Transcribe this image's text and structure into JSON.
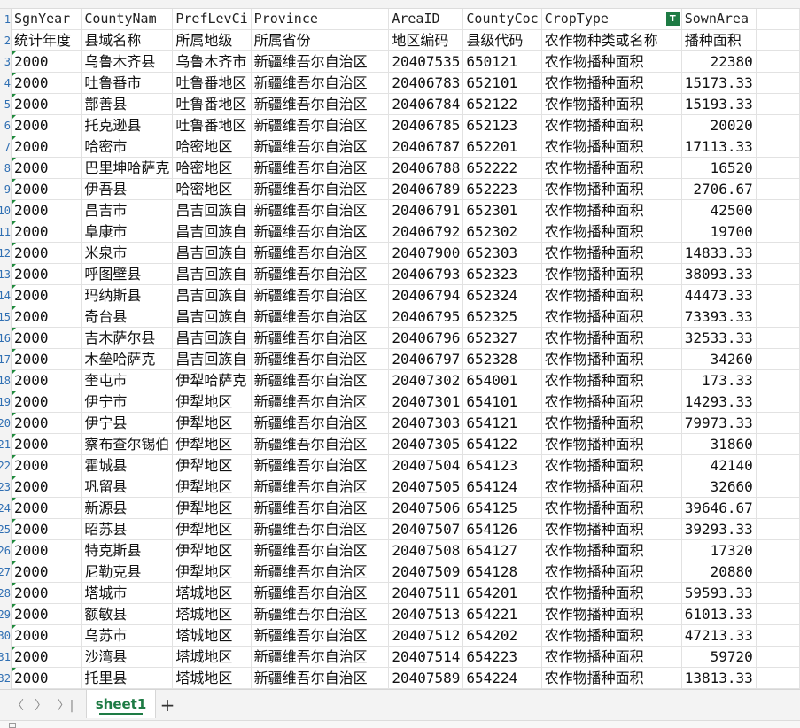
{
  "headers_en": [
    "SgnYear",
    "CountyNam",
    "PrefLevCi",
    "Province",
    "AreaID",
    "CountyCoc",
    "CropType",
    "SownArea"
  ],
  "headers_cn": [
    "统计年度",
    "县域名称",
    "所属地级",
    "所属省份",
    "地区编码",
    "县级代码",
    "农作物种类或名称",
    "播种面积"
  ],
  "rows": [
    [
      "2000",
      "乌鲁木齐县",
      "乌鲁木齐市",
      "新疆维吾尔自治区",
      "20407535",
      "650121",
      "农作物播种面积",
      "22380"
    ],
    [
      "2000",
      "吐鲁番市",
      "吐鲁番地区",
      "新疆维吾尔自治区",
      "20406783",
      "652101",
      "农作物播种面积",
      "15173.33"
    ],
    [
      "2000",
      "鄯善县",
      "吐鲁番地区",
      "新疆维吾尔自治区",
      "20406784",
      "652122",
      "农作物播种面积",
      "15193.33"
    ],
    [
      "2000",
      "托克逊县",
      "吐鲁番地区",
      "新疆维吾尔自治区",
      "20406785",
      "652123",
      "农作物播种面积",
      "20020"
    ],
    [
      "2000",
      "哈密市",
      "哈密地区",
      "新疆维吾尔自治区",
      "20406787",
      "652201",
      "农作物播种面积",
      "17113.33"
    ],
    [
      "2000",
      "巴里坤哈萨克",
      "哈密地区",
      "新疆维吾尔自治区",
      "20406788",
      "652222",
      "农作物播种面积",
      "16520"
    ],
    [
      "2000",
      "伊吾县",
      "哈密地区",
      "新疆维吾尔自治区",
      "20406789",
      "652223",
      "农作物播种面积",
      "2706.67"
    ],
    [
      "2000",
      "昌吉市",
      "昌吉回族自",
      "新疆维吾尔自治区",
      "20406791",
      "652301",
      "农作物播种面积",
      "42500"
    ],
    [
      "2000",
      "阜康市",
      "昌吉回族自",
      "新疆维吾尔自治区",
      "20406792",
      "652302",
      "农作物播种面积",
      "19700"
    ],
    [
      "2000",
      "米泉市",
      "昌吉回族自",
      "新疆维吾尔自治区",
      "20407900",
      "652303",
      "农作物播种面积",
      "14833.33"
    ],
    [
      "2000",
      "呼图壁县",
      "昌吉回族自",
      "新疆维吾尔自治区",
      "20406793",
      "652323",
      "农作物播种面积",
      "38093.33"
    ],
    [
      "2000",
      "玛纳斯县",
      "昌吉回族自",
      "新疆维吾尔自治区",
      "20406794",
      "652324",
      "农作物播种面积",
      "44473.33"
    ],
    [
      "2000",
      "奇台县",
      "昌吉回族自",
      "新疆维吾尔自治区",
      "20406795",
      "652325",
      "农作物播种面积",
      "73393.33"
    ],
    [
      "2000",
      "吉木萨尔县",
      "昌吉回族自",
      "新疆维吾尔自治区",
      "20406796",
      "652327",
      "农作物播种面积",
      "32533.33"
    ],
    [
      "2000",
      "木垒哈萨克",
      "昌吉回族自",
      "新疆维吾尔自治区",
      "20406797",
      "652328",
      "农作物播种面积",
      "34260"
    ],
    [
      "2000",
      "奎屯市",
      "伊犁哈萨克",
      "新疆维吾尔自治区",
      "20407302",
      "654001",
      "农作物播种面积",
      "173.33"
    ],
    [
      "2000",
      "伊宁市",
      "伊犁地区",
      "新疆维吾尔自治区",
      "20407301",
      "654101",
      "农作物播种面积",
      "14293.33"
    ],
    [
      "2000",
      "伊宁县",
      "伊犁地区",
      "新疆维吾尔自治区",
      "20407303",
      "654121",
      "农作物播种面积",
      "79973.33"
    ],
    [
      "2000",
      "察布查尔锡伯",
      "伊犁地区",
      "新疆维吾尔自治区",
      "20407305",
      "654122",
      "农作物播种面积",
      "31860"
    ],
    [
      "2000",
      "霍城县",
      "伊犁地区",
      "新疆维吾尔自治区",
      "20407504",
      "654123",
      "农作物播种面积",
      "42140"
    ],
    [
      "2000",
      "巩留县",
      "伊犁地区",
      "新疆维吾尔自治区",
      "20407505",
      "654124",
      "农作物播种面积",
      "32660"
    ],
    [
      "2000",
      "新源县",
      "伊犁地区",
      "新疆维吾尔自治区",
      "20407506",
      "654125",
      "农作物播种面积",
      "39646.67"
    ],
    [
      "2000",
      "昭苏县",
      "伊犁地区",
      "新疆维吾尔自治区",
      "20407507",
      "654126",
      "农作物播种面积",
      "39293.33"
    ],
    [
      "2000",
      "特克斯县",
      "伊犁地区",
      "新疆维吾尔自治区",
      "20407508",
      "654127",
      "农作物播种面积",
      "17320"
    ],
    [
      "2000",
      "尼勒克县",
      "伊犁地区",
      "新疆维吾尔自治区",
      "20407509",
      "654128",
      "农作物播种面积",
      "20880"
    ],
    [
      "2000",
      "塔城市",
      "塔城地区",
      "新疆维吾尔自治区",
      "20407511",
      "654201",
      "农作物播种面积",
      "59593.33"
    ],
    [
      "2000",
      "额敏县",
      "塔城地区",
      "新疆维吾尔自治区",
      "20407513",
      "654221",
      "农作物播种面积",
      "61013.33"
    ],
    [
      "2000",
      "乌苏市",
      "塔城地区",
      "新疆维吾尔自治区",
      "20407512",
      "654202",
      "农作物播种面积",
      "47213.33"
    ],
    [
      "2000",
      "沙湾县",
      "塔城地区",
      "新疆维吾尔自治区",
      "20407514",
      "654223",
      "农作物播种面积",
      "59720"
    ],
    [
      "2000",
      "托里县",
      "塔城地区",
      "新疆维吾尔自治区",
      "20407589",
      "654224",
      "农作物播种面积",
      "13813.33"
    ]
  ],
  "row_numbers": [
    "1",
    "2",
    "3",
    "4",
    "5",
    "6",
    "7",
    "8",
    "9",
    "10",
    "11",
    "12",
    "13",
    "14",
    "15",
    "16",
    "17",
    "18",
    "19",
    "20",
    "21",
    "22",
    "23",
    "24",
    "25",
    "26",
    "27",
    "28",
    "29",
    "30",
    "31",
    "32"
  ],
  "filter_icon": "filter-icon",
  "sheet_tabs": [
    {
      "label": "sheet1",
      "active": true
    }
  ],
  "nav": {
    "first": "〈",
    "prev": "〈",
    "next": "〉",
    "last": "〉|",
    "add": "+"
  },
  "colors": {
    "accent": "#1e7b44",
    "cell_marker": "#1f8a3c"
  }
}
